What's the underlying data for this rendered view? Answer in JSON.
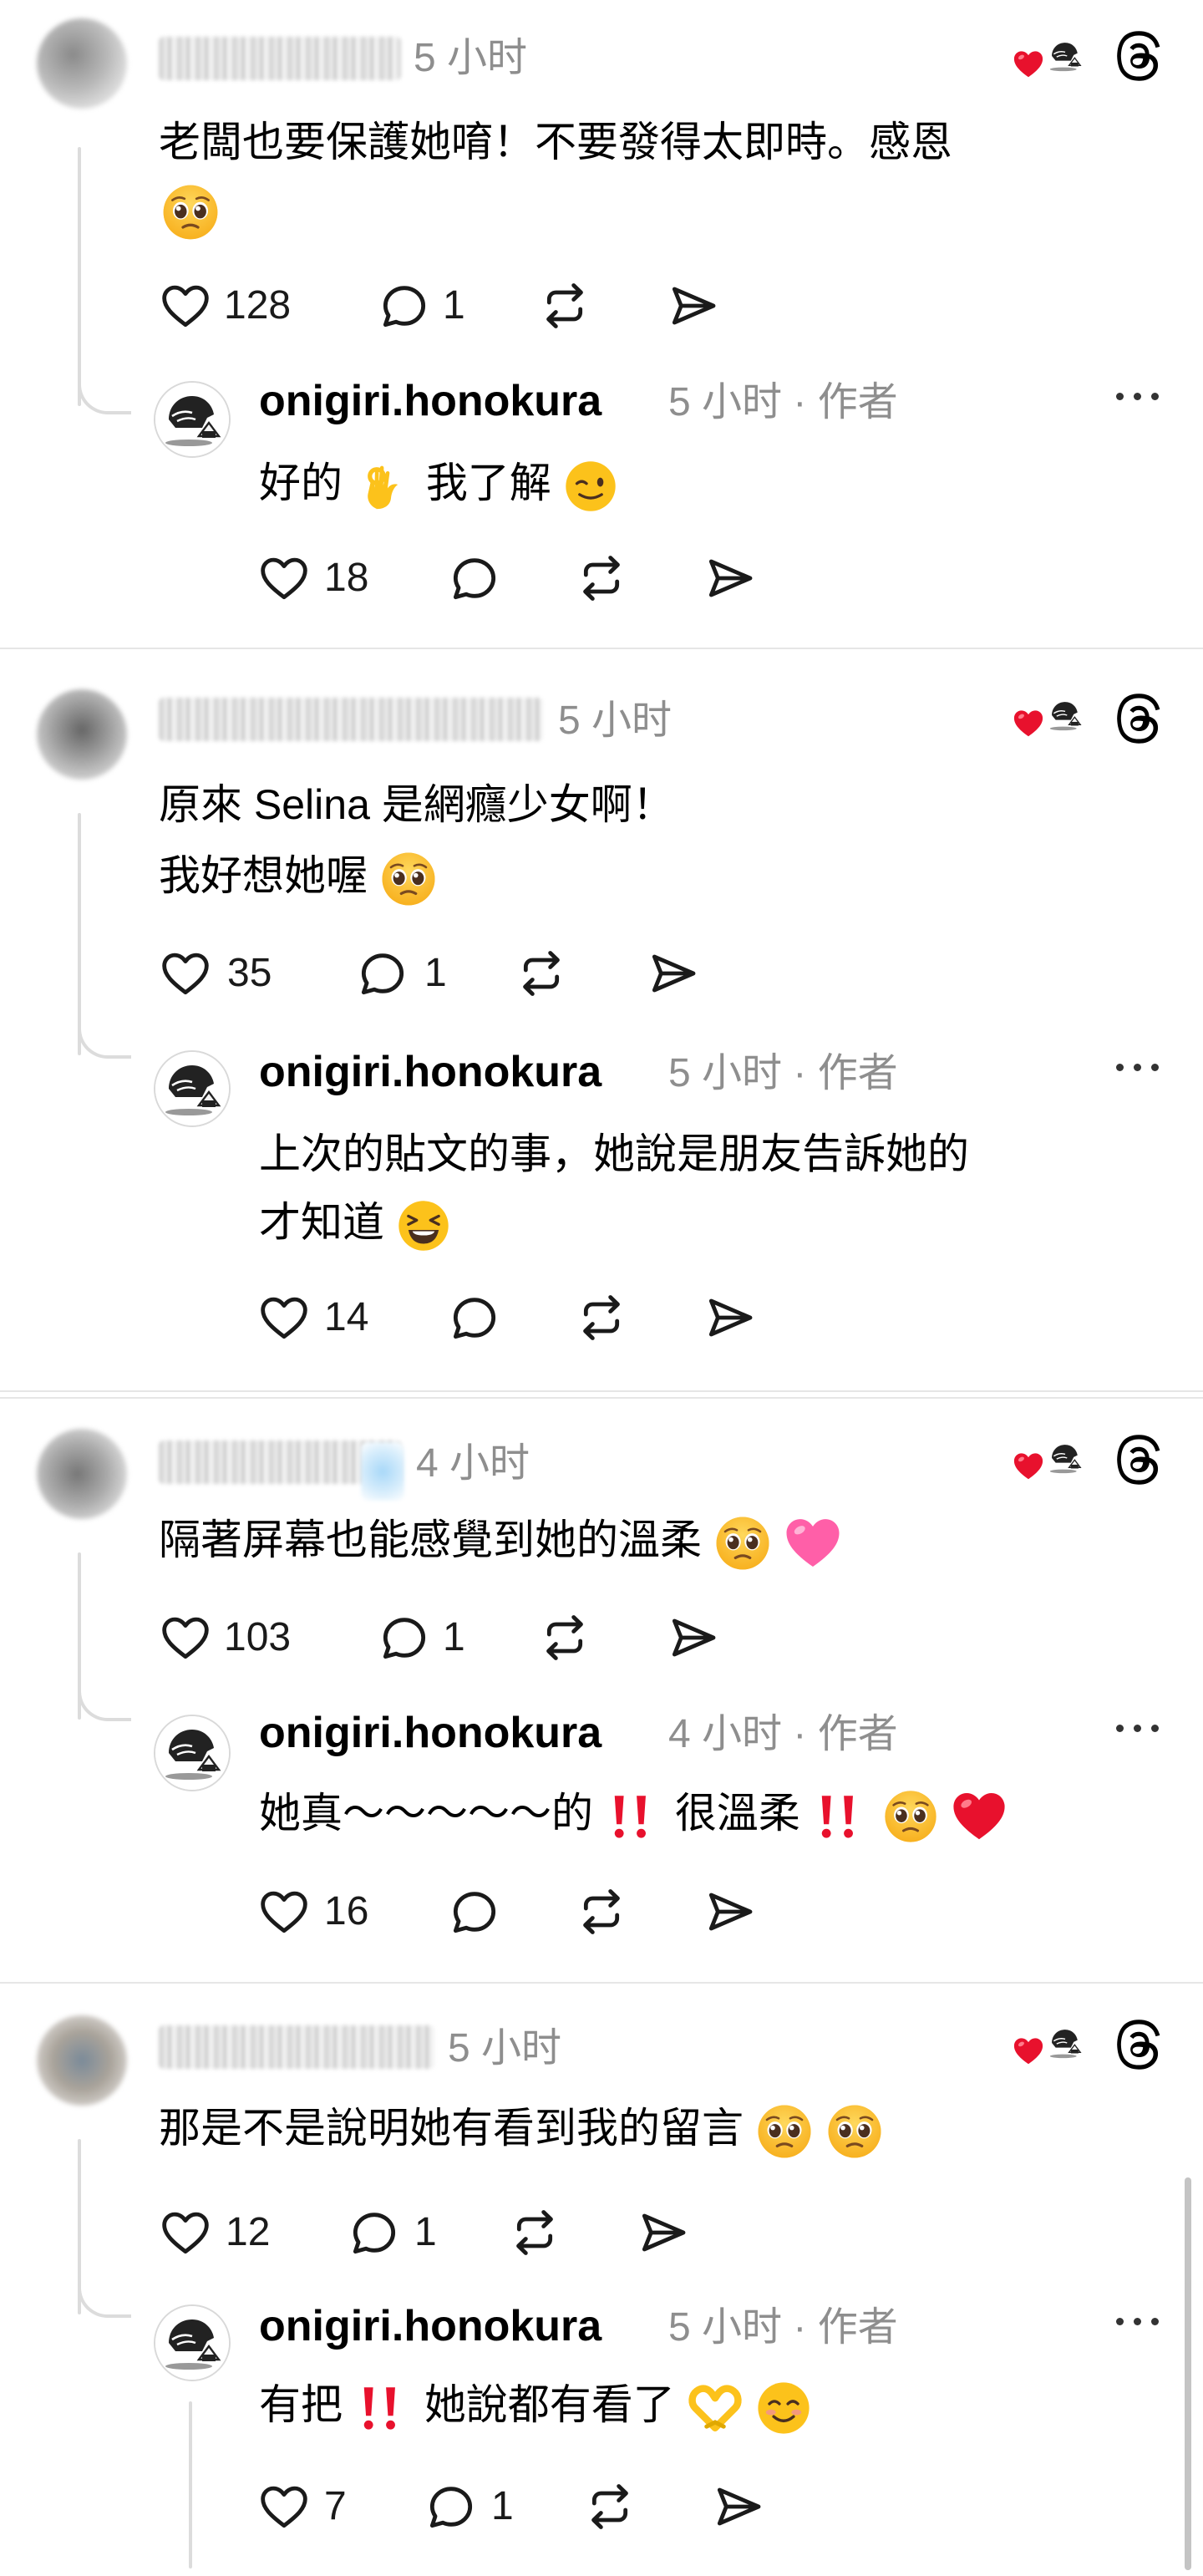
{
  "icons": {
    "like": "heart-outline-icon",
    "reply": "comment-bubble-icon",
    "repost": "repost-icon",
    "share": "send-icon",
    "more": "more-dots-icon",
    "threads": "threads-logo-icon"
  },
  "colors": {
    "heart_red": "#e0163b",
    "muted": "#8e8e8e"
  },
  "threads": [
    {
      "comment": {
        "time": "5 小时",
        "lines": [
          "老闆也要保護她唷！不要發得太即時。感恩"
        ],
        "likes": "128",
        "replies": "1"
      },
      "reply": {
        "username": "onigiri.honokura",
        "meta": "5 小时 · 作者",
        "lines": [
          "好的",
          "我了解"
        ],
        "likes": "18",
        "replies": ""
      }
    },
    {
      "comment": {
        "time": "5 小时",
        "lines": [
          "原來 Selina 是網癮少女啊！",
          "我好想她喔"
        ],
        "likes": "35",
        "replies": "1"
      },
      "reply": {
        "username": "onigiri.honokura",
        "meta": "5 小时 · 作者",
        "lines": [
          "上次的貼文的事，她說是朋友告訴她的",
          "才知道"
        ],
        "likes": "14",
        "replies": ""
      }
    },
    {
      "comment": {
        "time": "4 小时",
        "lines": [
          "隔著屏幕也能感覺到她的溫柔"
        ],
        "likes": "103",
        "replies": "1"
      },
      "reply": {
        "username": "onigiri.honokura",
        "meta": "4 小时 · 作者",
        "lines": [
          "她真～～～～～的",
          "很溫柔"
        ],
        "likes": "16",
        "replies": ""
      }
    },
    {
      "comment": {
        "time": "5 小时",
        "lines": [
          "那是不是說明她有看到我的留言"
        ],
        "likes": "12",
        "replies": "1"
      },
      "reply": {
        "username": "onigiri.honokura",
        "meta": "5 小时 · 作者",
        "lines": [
          "有把",
          "她說都有看了"
        ],
        "likes": "7",
        "replies": "1"
      }
    }
  ]
}
